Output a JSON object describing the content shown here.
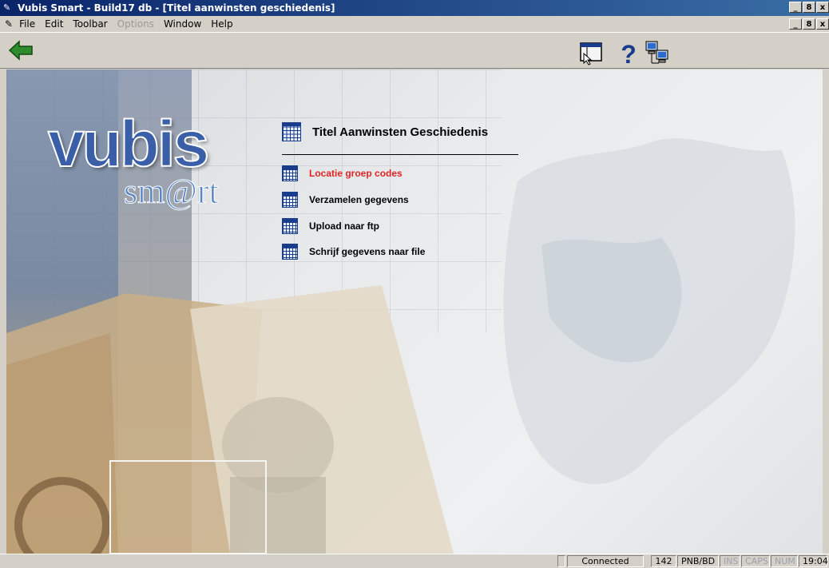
{
  "window": {
    "title": "Vubis Smart - Build17 db - [Titel aanwinsten geschiedenis]",
    "controls": [
      "_",
      "8",
      "x"
    ]
  },
  "menubar": {
    "items": [
      {
        "label": "File",
        "enabled": true
      },
      {
        "label": "Edit",
        "enabled": true
      },
      {
        "label": "Toolbar",
        "enabled": true
      },
      {
        "label": "Options",
        "enabled": false
      },
      {
        "label": "Window",
        "enabled": true
      },
      {
        "label": "Help",
        "enabled": true
      }
    ]
  },
  "toolbar": {
    "back_icon": "back-arrow-icon",
    "right_icons": [
      "login-window-icon",
      "help-question-icon",
      "network-computers-icon"
    ],
    "accent_color": "#2e8b2e"
  },
  "logo": {
    "primary": "vubis",
    "secondary": "sm@rt"
  },
  "menu": {
    "heading": "Titel Aanwinsten Geschiedenis",
    "items": [
      {
        "label": "Locatie groep codes",
        "active": true
      },
      {
        "label": "Verzamelen gegevens",
        "active": false
      },
      {
        "label": "Upload naar ftp",
        "active": false
      },
      {
        "label": "Schrijf gegevens naar file",
        "active": false
      }
    ],
    "active_color": "#e02424"
  },
  "statusbar": {
    "status": "Connected",
    "count": "142",
    "location": "PNB/BD",
    "ins": "INS",
    "caps": "CAPS",
    "num": "NUM",
    "time": "19:04"
  }
}
